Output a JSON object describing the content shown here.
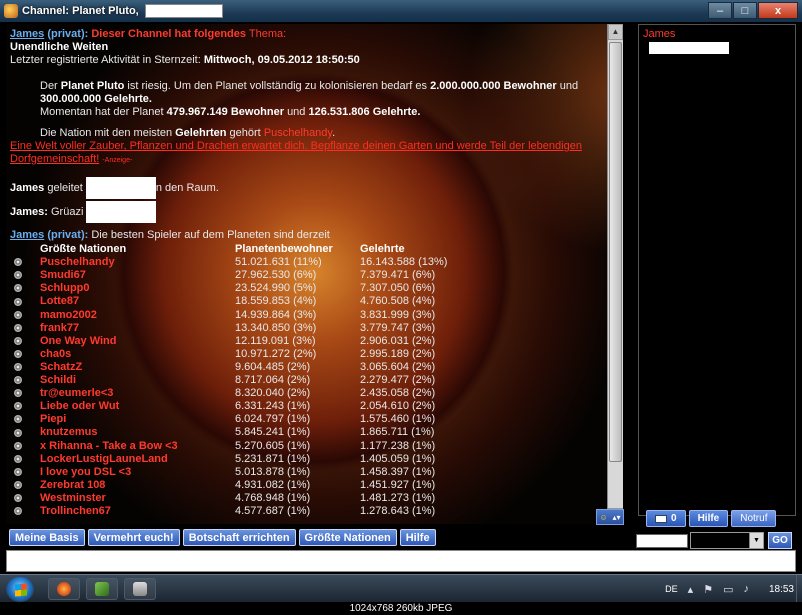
{
  "window": {
    "title": "Channel: Planet Pluto,",
    "ghost_tabs": [
      "",
      "",
      ""
    ],
    "controls": {
      "minimize": "–",
      "maximize": "□",
      "close": "x"
    }
  },
  "chat": {
    "msg1": {
      "nick": "James",
      "priv": "(privat):",
      "head": "Dieser Channel hat folgendes",
      "head2": "Thema:",
      "line1": "Unendliche Weiten",
      "line2_pre": "Letzter registrierte Aktivität in Sternzeit:",
      "line2_date": "Mittwoch, 09.05.2012 18:50:50",
      "p1_a": "Der",
      "p1_b": "Planet Pluto",
      "p1_c": "ist riesig. Um den Planet vollständig zu kolonisieren bedarf es",
      "p1_d": "2.000.000.000 Bewohner",
      "p1_e": "und",
      "p1_f": "300.000.000 Gelehrte.",
      "p2_a": "Momentan hat der Planet",
      "p2_b": "479.967.149 Bewohner",
      "p2_c": "und",
      "p2_d": "126.531.806 Gelehrte.",
      "p3_a": "Die Nation mit den meisten",
      "p3_b": "Gelehrten",
      "p3_c": "gehört",
      "p3_d": "Puschelhandy",
      "p3_e": "."
    },
    "ad": {
      "line1": "Eine Welt voller Zauber, Pflanzen und Drachen erwartet dich. Bepflanze deinen Garten und werde Teil der lebendigen",
      "line2": "Dorfgemeinschaft!",
      "tag": "-Anzeige-"
    },
    "msg2": {
      "nick": "James",
      "text_a": "geleitet",
      "text_b": "n den Raum."
    },
    "msg3": {
      "nick": "James:",
      "text": "Grüazi"
    },
    "msg4": {
      "nick": "James",
      "priv": "(privat):",
      "text": "Die besten Spieler auf dem Planeten sind derzeit"
    },
    "ranking": {
      "headers": [
        "Größte Nationen",
        "Planetenbewohner",
        "Gelehrte"
      ],
      "rows": [
        [
          "Puschelhandy",
          "51.021.631 (11%)",
          "16.143.588 (13%)"
        ],
        [
          "Smudi67",
          "27.962.530 (6%)",
          "7.379.471 (6%)"
        ],
        [
          "Schlupp0",
          "23.524.990 (5%)",
          "7.307.050 (6%)"
        ],
        [
          "Lotte87",
          "18.559.853 (4%)",
          "4.760.508 (4%)"
        ],
        [
          "mamo2002",
          "14.939.864 (3%)",
          "3.831.999 (3%)"
        ],
        [
          "frank77",
          "13.340.850 (3%)",
          "3.779.747 (3%)"
        ],
        [
          "One Way Wind",
          "12.119.091 (3%)",
          "2.906.031 (2%)"
        ],
        [
          "cha0s",
          "10.971.272 (2%)",
          "2.995.189 (2%)"
        ],
        [
          "SchatzZ",
          "9.604.485 (2%)",
          "3.065.604 (2%)"
        ],
        [
          "Schildi",
          "8.717.064 (2%)",
          "2.279.477 (2%)"
        ],
        [
          "tr@eumerle<3",
          "8.320.040 (2%)",
          "2.435.058 (2%)"
        ],
        [
          "Liebe oder Wut",
          "6.331.243 (1%)",
          "2.054.610 (2%)"
        ],
        [
          "Piepi",
          "6.024.797 (1%)",
          "1.575.460 (1%)"
        ],
        [
          "knutzemus",
          "5.845.241 (1%)",
          "1.865.711 (1%)"
        ],
        [
          "x Rihanna - Take a Bow <3",
          "5.270.605 (1%)",
          "1.177.238 (1%)"
        ],
        [
          "LockerLustigLauneLand",
          "5.231.871 (1%)",
          "1.405.059 (1%)"
        ],
        [
          "I love you DSL <3",
          "5.013.878 (1%)",
          "1.458.397 (1%)"
        ],
        [
          "Zerebrat 108",
          "4.931.082 (1%)",
          "1.451.927 (1%)"
        ],
        [
          "Westminster",
          "4.768.948 (1%)",
          "1.481.273 (1%)"
        ],
        [
          "Trollinchen67",
          "4.577.687 (1%)",
          "1.278.643 (1%)"
        ]
      ]
    }
  },
  "userlist": {
    "users": [
      "James"
    ]
  },
  "right_buttons": {
    "mail_count": "0",
    "help": "Hilfe",
    "emergency": "Notruf"
  },
  "actions": [
    "Meine Basis",
    "Vermehrt euch!",
    "Botschaft errichten",
    "Größte Nationen",
    "Hilfe"
  ],
  "go_label": "GO",
  "taskbar": {
    "lang": "DE",
    "clock": "18:53"
  },
  "caption": "1024x768  260kb  JPEG",
  "colors": {
    "accent_red": "#ff3a2e",
    "nick_blue": "#6aaef0",
    "button_blue": "#2e58b5"
  }
}
